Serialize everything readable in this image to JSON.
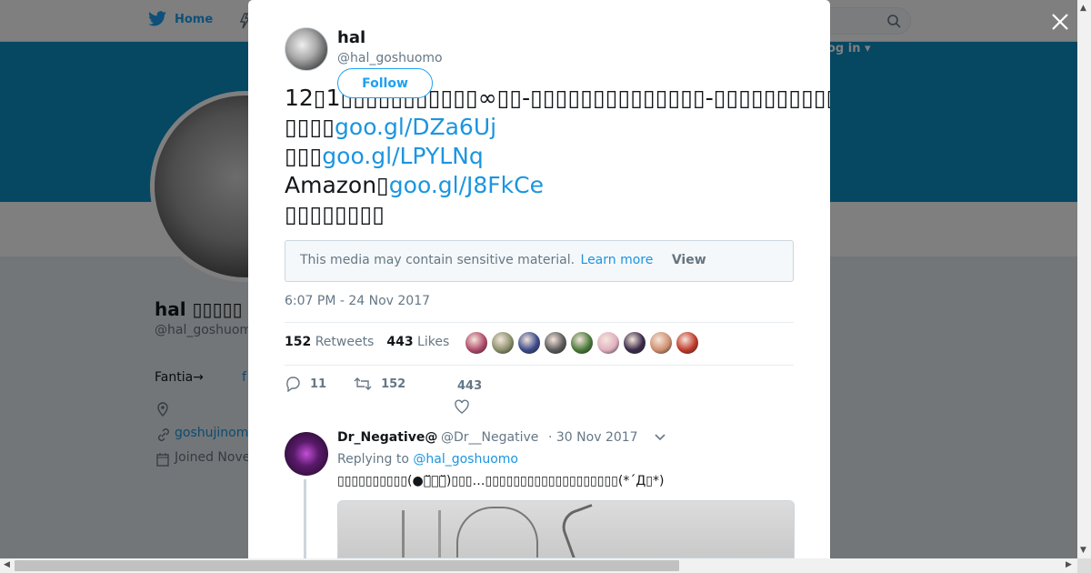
{
  "background": {
    "nav": {
      "home_label": "Home",
      "login_label": "og in ▾"
    },
    "profile": {
      "name": "hal ▯▯▯▯▯",
      "handle": "@hal_goshuomo",
      "bio_prefix": "Fantia→",
      "bio_link": "f",
      "url": "goshujinom",
      "joined": "Joined Nove"
    }
  },
  "modal": {
    "author": {
      "name": "hal",
      "handle": "@hal_goshuomo"
    },
    "follow_label": "Follow",
    "tweet": {
      "line1": "12▯1▯▯▯▯▯▯▯▯▯▯▯∞▯▯-▯▯▯▯▯▯▯▯▯▯▯▯▯▯-▯▯▯▯▯▯▯▯▯▯▯▯▯▯▯▯▯▯▯▯▯▯▯",
      "line2_prefix": "▯▯▯▯",
      "line2_link": "goo.gl/DZa6Uj",
      "line3_prefix": "▯▯▯",
      "line3_link": "goo.gl/LPYLNq",
      "line4_prefix": "Amazon▯",
      "line4_link": "goo.gl/J8FkCe",
      "line5": "▯▯▯▯▯▯▯▯"
    },
    "sensitive": {
      "message": "This media may contain sensitive material.",
      "learn_more": "Learn more",
      "view": "View"
    },
    "timestamp": "6:07 PM - 24 Nov 2017",
    "stats": {
      "retweets_count": "152",
      "retweets_label": "Retweets",
      "likes_count": "443",
      "likes_label": "Likes"
    },
    "liker_colors": [
      "#b04a6a",
      "#8a8f6a",
      "#3a4a8a",
      "#5a5a5a",
      "#4a7a3a",
      "#e0b0c0",
      "#3a2a4a",
      "#d09070",
      "#c03a2a"
    ],
    "actions": {
      "replies": "11",
      "retweets": "152",
      "likes": "443"
    }
  },
  "reply": {
    "name": "Dr_Negative@",
    "handle": "@Dr__Negative",
    "date": "· 30 Nov 2017",
    "replying_prefix": "Replying to",
    "replying_to": "@hal_goshuomo",
    "text": "▯▯▯▯▯▯▯▯▯▯(●･̆⍛･̆)▯▯▯…▯▯▯▯▯▯▯▯▯▯▯▯▯▯▯▯▯▯▯(*´Д▯*)"
  },
  "colors": {
    "accent": "#1da1f2",
    "link": "#1b95e0",
    "banner": "#0d8ec4"
  }
}
